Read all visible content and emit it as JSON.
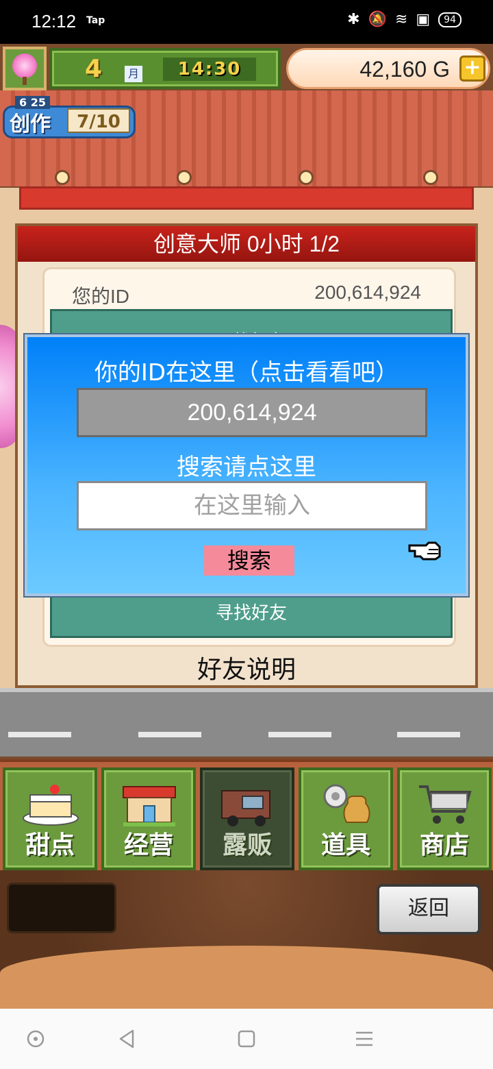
{
  "status_bar": {
    "time": "12:12",
    "tap": "Tap",
    "battery": "94"
  },
  "hud": {
    "month": "4",
    "month_label": "月",
    "clock": "14:30",
    "money": "42,160 G",
    "plus": "+"
  },
  "create_badge": {
    "small": "6 25",
    "label": "创作",
    "count": "7/10"
  },
  "panel": {
    "title": "创意大师  0小时 1/2",
    "id_label": "您的ID",
    "id_value": "200,614,924",
    "peek_top": "寻找好友",
    "peek_bottom": "寻找好友",
    "friend_explain": "好友说明"
  },
  "dialog": {
    "title": "你的ID在这里（点击看看吧）",
    "id_display": "200,614,924",
    "search_hint": "搜索请点这里",
    "input_placeholder": "在这里输入",
    "search_button": "搜索"
  },
  "nav": {
    "items": [
      {
        "label": "甜点"
      },
      {
        "label": "经营"
      },
      {
        "label": "露贩"
      },
      {
        "label": "道具"
      },
      {
        "label": "商店"
      }
    ]
  },
  "bottom": {
    "return_label": "返回"
  }
}
